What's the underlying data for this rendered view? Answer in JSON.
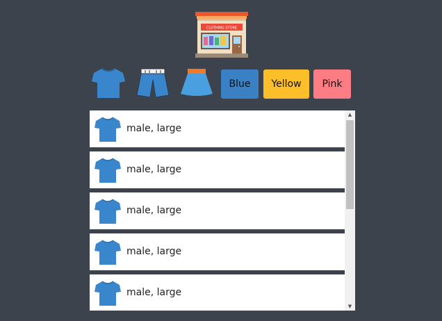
{
  "logo": {
    "sign_text": "CLOTHING STORE"
  },
  "filters": {
    "types": [
      {
        "name": "shirt"
      },
      {
        "name": "shorts"
      },
      {
        "name": "skirt"
      }
    ],
    "colors": [
      {
        "label": "Blue",
        "color": "#3a80c4"
      },
      {
        "label": "Yellow",
        "color": "#fcbf2a"
      },
      {
        "label": "Pink",
        "color": "#fe7c83"
      }
    ]
  },
  "items": [
    {
      "icon": "shirt-icon",
      "label": "male, large"
    },
    {
      "icon": "shirt-icon",
      "label": "male, large"
    },
    {
      "icon": "shirt-icon",
      "label": "male, large"
    },
    {
      "icon": "shirt-icon",
      "label": "male, large"
    },
    {
      "icon": "shirt-icon",
      "label": "male, large"
    }
  ],
  "colors": {
    "background": "#3d434c",
    "shirt": "#3a86cc"
  }
}
